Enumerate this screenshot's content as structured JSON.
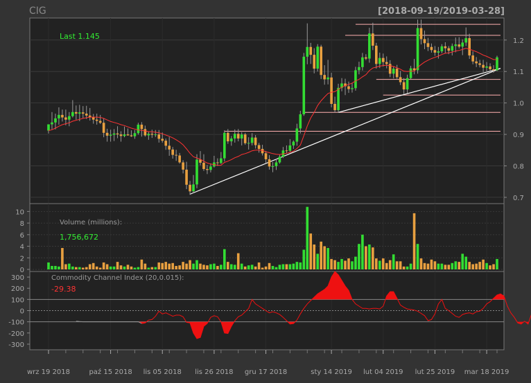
{
  "chart_data": [
    {
      "type": "candlestick",
      "ticker": "CIG",
      "date_range": "[2018-09-19/2019-03-28]",
      "last_label": "Last 1.145",
      "y_ticks": [
        "0.7",
        "0.8",
        "0.9",
        "1.0",
        "1.1",
        "1.2"
      ],
      "ylim": [
        0.68,
        1.27
      ],
      "x_tick_labels": [
        "wrz 19 2018",
        "paź 15 2018",
        "lis 05 2018",
        "lis 26 2018",
        "gru 17 2018",
        "sty 14 2019",
        "lut 04 2019",
        "lut 25 2019",
        "mar 18 2019"
      ],
      "x_tick_index": [
        0,
        18,
        33,
        48,
        63,
        82,
        97,
        112,
        127
      ],
      "colors": {
        "up": "#33dd33",
        "down": "#e8a040",
        "ma": "#ff3333",
        "support": "#ffb0b0",
        "trend": "#ffffff"
      },
      "ohlc": [
        [
          0.912,
          0.932,
          0.903,
          0.932
        ],
        [
          0.932,
          0.971,
          0.916,
          0.938
        ],
        [
          0.938,
          0.966,
          0.916,
          0.951
        ],
        [
          0.951,
          0.986,
          0.931,
          0.962
        ],
        [
          0.962,
          0.979,
          0.941,
          0.954
        ],
        [
          0.954,
          0.979,
          0.929,
          0.947
        ],
        [
          0.947,
          0.971,
          0.926,
          0.958
        ],
        [
          0.958,
          1.009,
          0.954,
          0.971
        ],
        [
          0.971,
          0.992,
          0.947,
          0.966
        ],
        [
          0.966,
          0.994,
          0.942,
          0.97
        ],
        [
          0.97,
          0.99,
          0.952,
          0.966
        ],
        [
          0.966,
          0.991,
          0.949,
          0.96
        ],
        [
          0.96,
          0.984,
          0.944,
          0.955
        ],
        [
          0.955,
          0.965,
          0.934,
          0.947
        ],
        [
          0.947,
          0.966,
          0.931,
          0.943
        ],
        [
          0.943,
          0.962,
          0.933,
          0.937
        ],
        [
          0.937,
          0.952,
          0.891,
          0.905
        ],
        [
          0.905,
          0.918,
          0.877,
          0.896
        ],
        [
          0.896,
          0.915,
          0.877,
          0.899
        ],
        [
          0.899,
          0.917,
          0.879,
          0.903
        ],
        [
          0.903,
          0.926,
          0.888,
          0.9
        ],
        [
          0.9,
          0.91,
          0.877,
          0.895
        ],
        [
          0.895,
          0.925,
          0.891,
          0.9
        ],
        [
          0.9,
          0.919,
          0.896,
          0.897
        ],
        [
          0.897,
          0.913,
          0.892,
          0.894
        ],
        [
          0.894,
          0.914,
          0.886,
          0.904
        ],
        [
          0.904,
          0.937,
          0.899,
          0.931
        ],
        [
          0.931,
          0.939,
          0.893,
          0.917
        ],
        [
          0.917,
          0.928,
          0.893,
          0.897
        ],
        [
          0.897,
          0.909,
          0.883,
          0.902
        ],
        [
          0.902,
          0.915,
          0.889,
          0.899
        ],
        [
          0.899,
          0.914,
          0.892,
          0.9
        ],
        [
          0.9,
          0.914,
          0.874,
          0.886
        ],
        [
          0.886,
          0.906,
          0.874,
          0.88
        ],
        [
          0.88,
          0.887,
          0.851,
          0.864
        ],
        [
          0.864,
          0.892,
          0.832,
          0.852
        ],
        [
          0.852,
          0.86,
          0.823,
          0.835
        ],
        [
          0.835,
          0.851,
          0.816,
          0.833
        ],
        [
          0.833,
          0.841,
          0.807,
          0.811
        ],
        [
          0.811,
          0.818,
          0.776,
          0.788
        ],
        [
          0.788,
          0.813,
          0.726,
          0.74
        ],
        [
          0.74,
          0.752,
          0.708,
          0.719
        ],
        [
          0.719,
          0.771,
          0.714,
          0.741
        ],
        [
          0.741,
          0.837,
          0.729,
          0.82
        ],
        [
          0.82,
          0.847,
          0.802,
          0.81
        ],
        [
          0.81,
          0.837,
          0.784,
          0.79
        ],
        [
          0.79,
          0.803,
          0.774,
          0.787
        ],
        [
          0.787,
          0.808,
          0.779,
          0.798
        ],
        [
          0.798,
          0.832,
          0.795,
          0.811
        ],
        [
          0.811,
          0.824,
          0.8,
          0.809
        ],
        [
          0.809,
          0.844,
          0.806,
          0.824
        ],
        [
          0.824,
          0.913,
          0.814,
          0.905
        ],
        [
          0.905,
          0.917,
          0.87,
          0.878
        ],
        [
          0.878,
          0.895,
          0.864,
          0.887
        ],
        [
          0.887,
          0.916,
          0.874,
          0.902
        ],
        [
          0.902,
          0.917,
          0.878,
          0.887
        ],
        [
          0.887,
          0.907,
          0.865,
          0.9
        ],
        [
          0.9,
          0.905,
          0.867,
          0.872
        ],
        [
          0.872,
          0.891,
          0.852,
          0.873
        ],
        [
          0.873,
          0.904,
          0.865,
          0.89
        ],
        [
          0.89,
          0.898,
          0.855,
          0.866
        ],
        [
          0.866,
          0.873,
          0.842,
          0.854
        ],
        [
          0.854,
          0.867,
          0.833,
          0.84
        ],
        [
          0.84,
          0.847,
          0.81,
          0.821
        ],
        [
          0.821,
          0.834,
          0.788,
          0.798
        ],
        [
          0.798,
          0.812,
          0.78,
          0.799
        ],
        [
          0.799,
          0.822,
          0.787,
          0.811
        ],
        [
          0.811,
          0.835,
          0.807,
          0.829
        ],
        [
          0.829,
          0.86,
          0.825,
          0.849
        ],
        [
          0.849,
          0.865,
          0.839,
          0.848
        ],
        [
          0.848,
          0.885,
          0.843,
          0.865
        ],
        [
          0.865,
          0.881,
          0.854,
          0.877
        ],
        [
          0.877,
          0.934,
          0.864,
          0.919
        ],
        [
          0.919,
          0.975,
          0.903,
          0.964
        ],
        [
          0.964,
          1.159,
          0.959,
          1.147
        ],
        [
          1.147,
          1.253,
          1.123,
          1.178
        ],
        [
          1.178,
          1.191,
          1.124,
          1.153
        ],
        [
          1.153,
          1.174,
          1.094,
          1.109
        ],
        [
          1.109,
          1.187,
          1.1,
          1.179
        ],
        [
          1.179,
          1.185,
          1.076,
          1.089
        ],
        [
          1.089,
          1.12,
          1.058,
          1.075
        ],
        [
          1.075,
          1.137,
          1.059,
          1.081
        ],
        [
          1.081,
          1.096,
          0.986,
          0.997
        ],
        [
          0.997,
          1.02,
          0.97,
          0.977
        ],
        [
          0.977,
          1.061,
          0.969,
          1.048
        ],
        [
          1.048,
          1.079,
          1.037,
          1.062
        ],
        [
          1.062,
          1.077,
          1.025,
          1.053
        ],
        [
          1.053,
          1.068,
          1.032,
          1.044
        ],
        [
          1.044,
          1.064,
          1.033,
          1.047
        ],
        [
          1.047,
          1.115,
          1.039,
          1.104
        ],
        [
          1.104,
          1.131,
          1.091,
          1.114
        ],
        [
          1.114,
          1.159,
          1.103,
          1.145
        ],
        [
          1.145,
          1.155,
          1.136,
          1.141
        ],
        [
          1.141,
          1.239,
          1.128,
          1.221
        ],
        [
          1.221,
          1.255,
          1.168,
          1.182
        ],
        [
          1.182,
          1.191,
          1.109,
          1.124
        ],
        [
          1.124,
          1.16,
          1.111,
          1.143
        ],
        [
          1.143,
          1.157,
          1.116,
          1.13
        ],
        [
          1.13,
          1.148,
          1.11,
          1.124
        ],
        [
          1.124,
          1.136,
          1.082,
          1.093
        ],
        [
          1.093,
          1.116,
          1.078,
          1.109
        ],
        [
          1.109,
          1.121,
          1.077,
          1.082
        ],
        [
          1.082,
          1.102,
          1.057,
          1.066
        ],
        [
          1.066,
          1.079,
          1.028,
          1.043
        ],
        [
          1.043,
          1.09,
          1.031,
          1.079
        ],
        [
          1.079,
          1.118,
          1.075,
          1.11
        ],
        [
          1.11,
          1.14,
          1.091,
          1.104
        ],
        [
          1.104,
          1.265,
          1.093,
          1.238
        ],
        [
          1.238,
          1.265,
          1.186,
          1.203
        ],
        [
          1.203,
          1.23,
          1.171,
          1.19
        ],
        [
          1.19,
          1.207,
          1.165,
          1.178
        ],
        [
          1.178,
          1.189,
          1.16,
          1.168
        ],
        [
          1.168,
          1.181,
          1.15,
          1.16
        ],
        [
          1.16,
          1.178,
          1.141,
          1.164
        ],
        [
          1.164,
          1.187,
          1.158,
          1.18
        ],
        [
          1.18,
          1.193,
          1.157,
          1.174
        ],
        [
          1.174,
          1.181,
          1.155,
          1.166
        ],
        [
          1.166,
          1.189,
          1.151,
          1.181
        ],
        [
          1.181,
          1.208,
          1.161,
          1.186
        ],
        [
          1.186,
          1.209,
          1.173,
          1.179
        ],
        [
          1.179,
          1.202,
          1.152,
          1.192
        ],
        [
          1.192,
          1.24,
          1.181,
          1.206
        ],
        [
          1.206,
          1.22,
          1.14,
          1.151
        ],
        [
          1.151,
          1.164,
          1.123,
          1.132
        ],
        [
          1.132,
          1.146,
          1.114,
          1.126
        ],
        [
          1.126,
          1.137,
          1.113,
          1.121
        ],
        [
          1.121,
          1.137,
          1.098,
          1.112
        ],
        [
          1.112,
          1.13,
          1.096,
          1.116
        ],
        [
          1.116,
          1.126,
          1.097,
          1.107
        ],
        [
          1.107,
          1.12,
          1.096,
          1.104
        ],
        [
          1.104,
          1.15,
          1.101,
          1.145
        ]
      ],
      "moving_average": [
        0.912,
        0.915,
        0.92,
        0.926,
        0.931,
        0.934,
        0.937,
        0.942,
        0.945,
        0.948,
        0.951,
        0.953,
        0.955,
        0.955,
        0.955,
        0.954,
        0.951,
        0.946,
        0.941,
        0.938,
        0.935,
        0.931,
        0.928,
        0.924,
        0.92,
        0.917,
        0.914,
        0.913,
        0.911,
        0.909,
        0.908,
        0.907,
        0.905,
        0.902,
        0.898,
        0.894,
        0.889,
        0.883,
        0.876,
        0.867,
        0.854,
        0.84,
        0.829,
        0.825,
        0.821,
        0.815,
        0.809,
        0.806,
        0.804,
        0.802,
        0.802,
        0.811,
        0.815,
        0.82,
        0.826,
        0.83,
        0.836,
        0.839,
        0.843,
        0.848,
        0.85,
        0.85,
        0.849,
        0.845,
        0.842,
        0.839,
        0.837,
        0.836,
        0.838,
        0.84,
        0.843,
        0.847,
        0.855,
        0.866,
        0.896,
        0.927,
        0.952,
        0.97,
        0.992,
        1.007,
        1.019,
        1.03,
        1.034,
        1.036,
        1.043,
        1.05,
        1.055,
        1.059,
        1.063,
        1.07,
        1.075,
        1.083,
        1.09,
        1.103,
        1.111,
        1.114,
        1.117,
        1.119,
        1.12,
        1.118,
        1.116,
        1.112,
        1.107,
        1.101,
        1.1,
        1.101,
        1.101,
        1.113,
        1.122,
        1.13,
        1.136,
        1.141,
        1.145,
        1.149,
        1.154,
        1.158,
        1.159,
        1.162,
        1.165,
        1.167,
        1.17,
        1.174,
        1.171,
        1.167,
        1.163,
        1.158,
        1.152,
        1.148,
        1.143,
        1.138,
        1.138
      ],
      "support_lines": [
        {
          "y": 0.91,
          "from_index": 51
        },
        {
          "y": 0.97,
          "from_index": 74
        },
        {
          "y": 1.025,
          "from_index": 97
        },
        {
          "y": 1.075,
          "from_index": 95
        },
        {
          "y": 1.215,
          "from_index": 86
        },
        {
          "y": 1.25,
          "from_index": 89
        }
      ],
      "trend_lines": [
        {
          "x1": 41,
          "y1": 0.71,
          "x2": 150,
          "y2": 1.11
        },
        {
          "x1": 84,
          "y1": 0.97,
          "x2": 150,
          "y2": 1.11
        }
      ]
    },
    {
      "type": "bar",
      "label": "Volume (millions):",
      "value_label": "1,756,672",
      "y_ticks": [
        "0",
        "2",
        "4",
        "6",
        "8",
        "10"
      ],
      "ylim": [
        0,
        11
      ],
      "values": [
        1.2,
        0.6,
        0.6,
        0.5,
        3.7,
        0.9,
        1.0,
        0.5,
        0.4,
        0.4,
        0.3,
        0.4,
        0.9,
        1.1,
        0.5,
        0.3,
        1.2,
        0.9,
        0.5,
        0.5,
        1.3,
        0.7,
        0.5,
        0.8,
        0.5,
        0.3,
        0.4,
        1.7,
        1.0,
        0.3,
        0.4,
        0.4,
        1.2,
        1.1,
        1.3,
        1.0,
        1.1,
        0.6,
        0.7,
        1.3,
        1.0,
        1.6,
        1.0,
        1.6,
        1.0,
        0.8,
        0.7,
        0.9,
        1.0,
        0.6,
        0.8,
        3.5,
        1.3,
        0.9,
        0.8,
        2.8,
        1.0,
        0.5,
        0.7,
        0.8,
        0.5,
        1.2,
        0.3,
        0.5,
        1.1,
        0.6,
        0.4,
        0.8,
        0.9,
        0.9,
        0.9,
        1.0,
        1.3,
        1.2,
        3.4,
        10.8,
        6.2,
        4.3,
        2.7,
        4.8,
        4.0,
        3.7,
        1.8,
        1.6,
        1.3,
        1.8,
        1.5,
        1.9,
        1.4,
        2.2,
        4.4,
        6.0,
        4.0,
        4.3,
        3.8,
        1.9,
        1.5,
        1.9,
        1.1,
        1.6,
        2.6,
        1.4,
        1.4,
        0.5,
        0.5,
        1.0,
        9.7,
        4.4,
        1.9,
        1.1,
        1.0,
        1.7,
        1.4,
        1.0,
        1.0,
        0.8,
        0.8,
        1.1,
        1.4,
        1.3,
        2.7,
        2.2,
        1.3,
        0.9,
        1.0,
        1.3,
        1.7,
        1.1,
        0.7,
        0.9,
        1.8
      ]
    },
    {
      "type": "area",
      "label": "Commodity Channel Index (20,0.015):",
      "value_label": "-29.38",
      "y_ticks": [
        "-300",
        "-200",
        "-100",
        "0",
        "100",
        "200",
        "300"
      ],
      "ylim": [
        -350,
        350
      ],
      "reference_lines": [
        -100,
        100
      ],
      "zero_line": 0,
      "start_index": 8,
      "values": [
        -95,
        -98,
        -100,
        -100,
        -100,
        -100,
        -100,
        -100,
        -100,
        -100,
        -100,
        -100,
        -100,
        -100,
        -100,
        -100,
        -100,
        -100,
        -100,
        -115,
        -110,
        -85,
        -80,
        -50,
        -5,
        -30,
        -20,
        -35,
        -50,
        -40,
        -40,
        -55,
        -105,
        -110,
        -200,
        -250,
        -240,
        -140,
        -115,
        -60,
        -45,
        -55,
        -100,
        -200,
        -205,
        -140,
        -90,
        -55,
        -40,
        -10,
        20,
        100,
        60,
        40,
        20,
        0,
        -20,
        -10,
        -20,
        -35,
        -60,
        -90,
        -120,
        -115,
        -85,
        -30,
        20,
        60,
        90,
        120,
        150,
        170,
        190,
        220,
        300,
        350,
        320,
        270,
        220,
        180,
        100,
        60,
        40,
        20,
        20,
        15,
        20,
        20,
        15,
        40,
        130,
        170,
        170,
        110,
        50,
        30,
        15,
        10,
        5,
        -5,
        -25,
        -45,
        -90,
        -80,
        -30,
        60,
        100,
        20,
        0,
        -25,
        -50,
        -60,
        -35,
        -25,
        -20,
        -30,
        -10,
        -5,
        20,
        60,
        80,
        110,
        140,
        150,
        130,
        40,
        -20,
        -60,
        -110,
        -120,
        -95,
        -120,
        -29
      ]
    }
  ]
}
